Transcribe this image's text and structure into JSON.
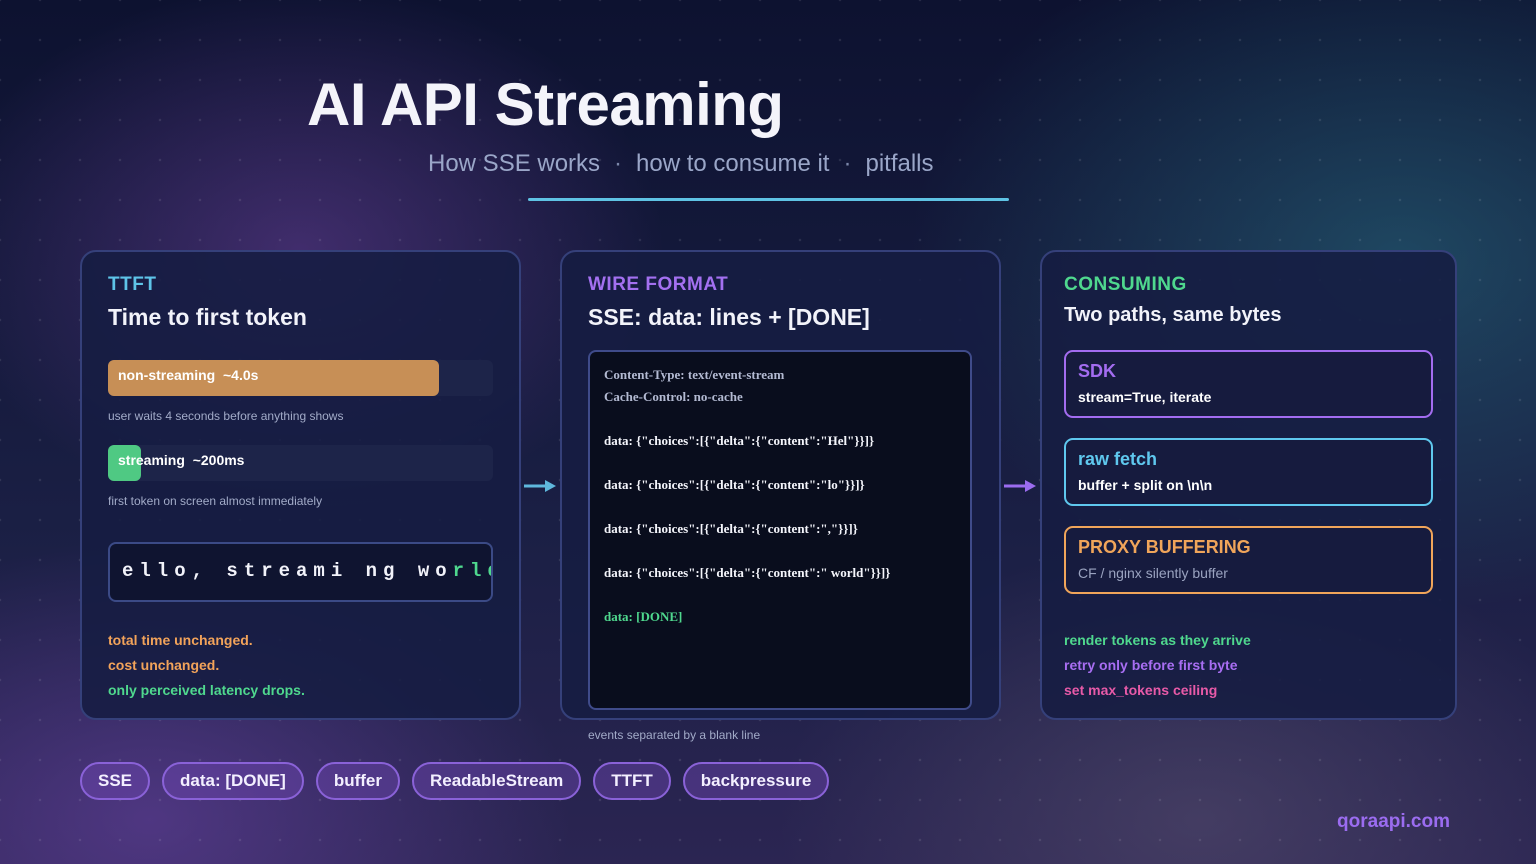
{
  "header": {
    "title": "AI API Streaming",
    "subtitle_parts": [
      "How SSE works",
      "how to consume it",
      "pitfalls"
    ],
    "separator": "·"
  },
  "ttft_panel": {
    "kicker": "TTFT",
    "heading": "Time to first token",
    "non_streaming": {
      "label": "non-streaming  ~4.0s",
      "caption": "user waits 4 seconds before anything shows",
      "fill_fraction": 0.86,
      "color": "#c78f56"
    },
    "streaming": {
      "label": "streaming  ~200ms",
      "caption": "first token on screen almost immediately",
      "fill_fraction": 0.085,
      "color": "#4fc983"
    },
    "stream_text": {
      "plain": "ello,  streami ng  wo",
      "highlight": "rld"
    },
    "notes": [
      {
        "text": "total time unchanged.",
        "color": "#f2a35a"
      },
      {
        "text": "cost unchanged.",
        "color": "#f2a35a"
      },
      {
        "text": "only perceived latency drops.",
        "color": "#4fd88e"
      }
    ]
  },
  "wire_panel": {
    "kicker": "WIRE FORMAT",
    "heading": "SSE: data: lines + [DONE]",
    "code_lines": [
      "Content-Type: text/event-stream",
      "Cache-Control: no-cache",
      "",
      "data: {\"choices\":[{\"delta\":{\"content\":\"Hel\"}}]}",
      "",
      "data: {\"choices\":[{\"delta\":{\"content\":\"lo\"}}]}",
      "",
      "data: {\"choices\":[{\"delta\":{\"content\":\",\"}}]}",
      "",
      "data: {\"choices\":[{\"delta\":{\"content\":\" world\"}}]}",
      "",
      "data: [DONE]"
    ],
    "caption": "events separated by a blank line"
  },
  "consuming_panel": {
    "kicker": "CONSUMING",
    "heading": "Two paths, same bytes",
    "options": [
      {
        "title": "SDK",
        "desc": "stream=True, iterate",
        "color": "#a36cf0"
      },
      {
        "title": "raw fetch",
        "desc": "buffer + split on \\n\\n",
        "color": "#5fc8ee"
      },
      {
        "title": "PROXY BUFFERING",
        "desc": "CF / nginx silently buffer",
        "color": "#f0a55a"
      }
    ],
    "tips": [
      {
        "text": "render tokens as they arrive",
        "color": "#4fd88e"
      },
      {
        "text": "retry only before first byte",
        "color": "#a86ef2"
      },
      {
        "text": "set max_tokens ceiling",
        "color": "#e85aa8"
      }
    ]
  },
  "tags": [
    "SSE",
    "data: [DONE]",
    "buffer",
    "ReadableStream",
    "TTFT",
    "backpressure"
  ],
  "brand": "qoraapi.com",
  "colors": {
    "ttft": "#5ec4e8",
    "wire": "#a370f0",
    "consuming": "#4fd88e",
    "arrow1": "#5fb8dd",
    "arrow2": "#9b6cf0"
  }
}
